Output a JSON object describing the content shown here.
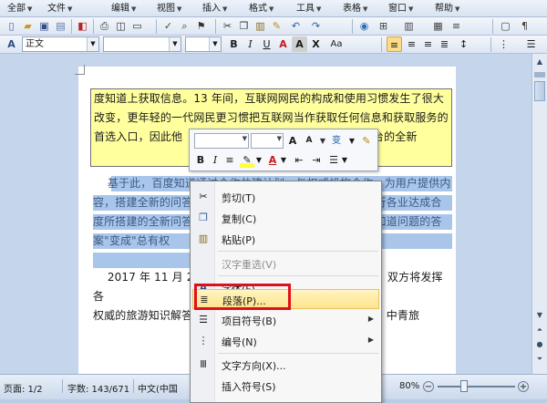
{
  "menu": [
    "全部",
    "文件",
    "编辑",
    "视图",
    "插入",
    "格式",
    "工具",
    "表格",
    "窗口",
    "帮助"
  ],
  "toolbar": {
    "style_value": "正文",
    "bold_label": "B",
    "italic_label": "I",
    "underline_label": "U",
    "font_color_label": "A",
    "char_shading_label": "A",
    "char_scale_label": "X",
    "change_case_label": "Aa"
  },
  "document": {
    "para1": "度知道上获取信息。13 年间，互联网网民的构成和使用习惯发生了很大改变，更年轻的一代网民更习惯把互联网当作获取任何信息和获取服务的首选入口，因此他                      全面成为他们对知识平台的全新",
    "para2": "    基于此，百度知道通过合作共建计划，与权威机构合作，为用户提供内容，搭建全新的问答                          出版社、金融等各行各业达成合                          度所搭建的全新问答生态也将与各                          个人知道问题的答案\"变成\"总有权",
    "para3": "    2017 年 11 月 2                          签署战略合作协议，双方将发挥各                          领域，开展知识生产、分发、分享                          权威的旅游知识解答内容，探索互                          模式。中青旅"
  },
  "mini_toolbar": {
    "grow_font": "A",
    "shrink_font": "A",
    "phonetic": "变",
    "bold": "B",
    "italic": "I",
    "font_color": "A"
  },
  "context_menu": {
    "items": [
      {
        "label": "剪切(T)",
        "icon": "scissors-icon",
        "enabled": true
      },
      {
        "label": "复制(C)",
        "icon": "copy-icon",
        "enabled": true
      },
      {
        "label": "粘贴(P)",
        "icon": "paste-icon",
        "enabled": true
      },
      {
        "label": "汉字重选(V)",
        "icon": "",
        "enabled": false
      },
      {
        "label": "字体(F)...",
        "icon": "font-icon",
        "enabled": true
      },
      {
        "label": "段落(P)...",
        "icon": "paragraph-icon",
        "enabled": true,
        "highlighted": true
      },
      {
        "label": "项目符号(B)",
        "icon": "bullets-icon",
        "enabled": true,
        "submenu": true
      },
      {
        "label": "编号(N)",
        "icon": "numbering-icon",
        "enabled": true,
        "submenu": true
      },
      {
        "label": "文字方向(X)...",
        "icon": "text-direction-icon",
        "enabled": true
      },
      {
        "label": "插入符号(S)",
        "icon": "",
        "enabled": true
      }
    ]
  },
  "status": {
    "page": "页面: 1/2",
    "words": "字数: 143/671",
    "lang": "中文(中国",
    "zoom": "80%"
  },
  "colors": {
    "highlight_yellow": "#ffff9e",
    "selection_blue": "#a9c6ea",
    "annotation_red": "#e0101a",
    "menu_hover": "#fde58c"
  }
}
